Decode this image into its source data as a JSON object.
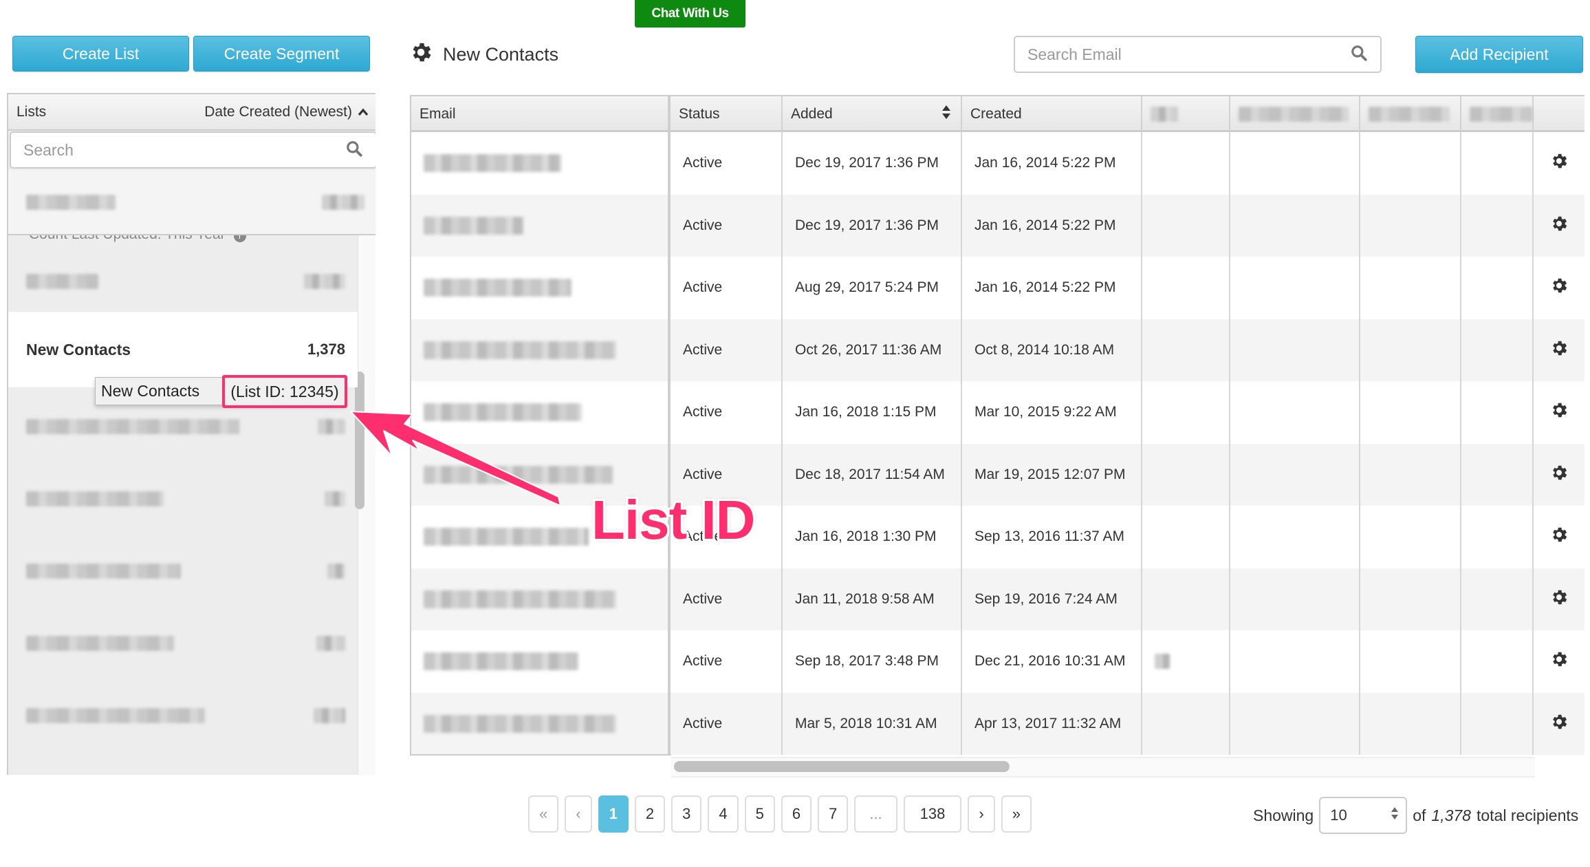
{
  "chat_button": "Chat With Us",
  "toolbar": {
    "create_list": "Create List",
    "create_segment": "Create Segment",
    "add_recipient": "Add Recipient",
    "search_email_placeholder": "Search Email"
  },
  "list_title": "New Contacts",
  "sidebar": {
    "header_label": "Lists",
    "sort_label": "Date Created (Newest)",
    "search_placeholder": "Search",
    "count_updated": "Count Last Updated: This Year",
    "selected_list": {
      "name": "New Contacts",
      "count": "1,378"
    },
    "tooltip": {
      "name": "New Contacts",
      "list_id": "(List ID: 12345)"
    }
  },
  "table": {
    "columns": [
      "Email",
      "Status",
      "Added",
      "Created"
    ],
    "rows": [
      {
        "status": "Active",
        "added": "Dec 19, 2017 1:36 PM",
        "created": "Jan 16, 2014 5:22 PM"
      },
      {
        "status": "Active",
        "added": "Dec 19, 2017 1:36 PM",
        "created": "Jan 16, 2014 5:22 PM"
      },
      {
        "status": "Active",
        "added": "Aug 29, 2017 5:24 PM",
        "created": "Jan 16, 2014 5:22 PM"
      },
      {
        "status": "Active",
        "added": "Oct 26, 2017 11:36 AM",
        "created": "Oct 8, 2014 10:18 AM"
      },
      {
        "status": "Active",
        "added": "Jan 16, 2018 1:15 PM",
        "created": "Mar 10, 2015 9:22 AM"
      },
      {
        "status": "Active",
        "added": "Dec 18, 2017 11:54 AM",
        "created": "Mar 19, 2015 12:07 PM"
      },
      {
        "status": "Active",
        "added": "Jan 16, 2018 1:30 PM",
        "created": "Sep 13, 2016 11:37 AM"
      },
      {
        "status": "Active",
        "added": "Jan 11, 2018 9:58 AM",
        "created": "Sep 19, 2016 7:24 AM"
      },
      {
        "status": "Active",
        "added": "Sep 18, 2017 3:48 PM",
        "created": "Dec 21, 2016 10:31 AM"
      },
      {
        "status": "Active",
        "added": "Mar 5, 2018 10:31 AM",
        "created": "Apr 13, 2017 11:32 AM"
      }
    ]
  },
  "pagination": {
    "first": "«",
    "prev": "‹",
    "pages": [
      "1",
      "2",
      "3",
      "4",
      "5",
      "6",
      "7",
      "...",
      "138"
    ],
    "current": "1",
    "next": "›",
    "last": "»"
  },
  "footer": {
    "showing_label": "Showing",
    "per_page": "10",
    "of_label": "of",
    "total": "1,378",
    "total_suffix": "total recipients"
  },
  "annotation": {
    "label": "List ID",
    "color": "#ff2e6e"
  },
  "colors": {
    "primary_button": "#2ea9d2",
    "chat_button": "#0f8a10",
    "active_page": "#5bc0e0"
  }
}
